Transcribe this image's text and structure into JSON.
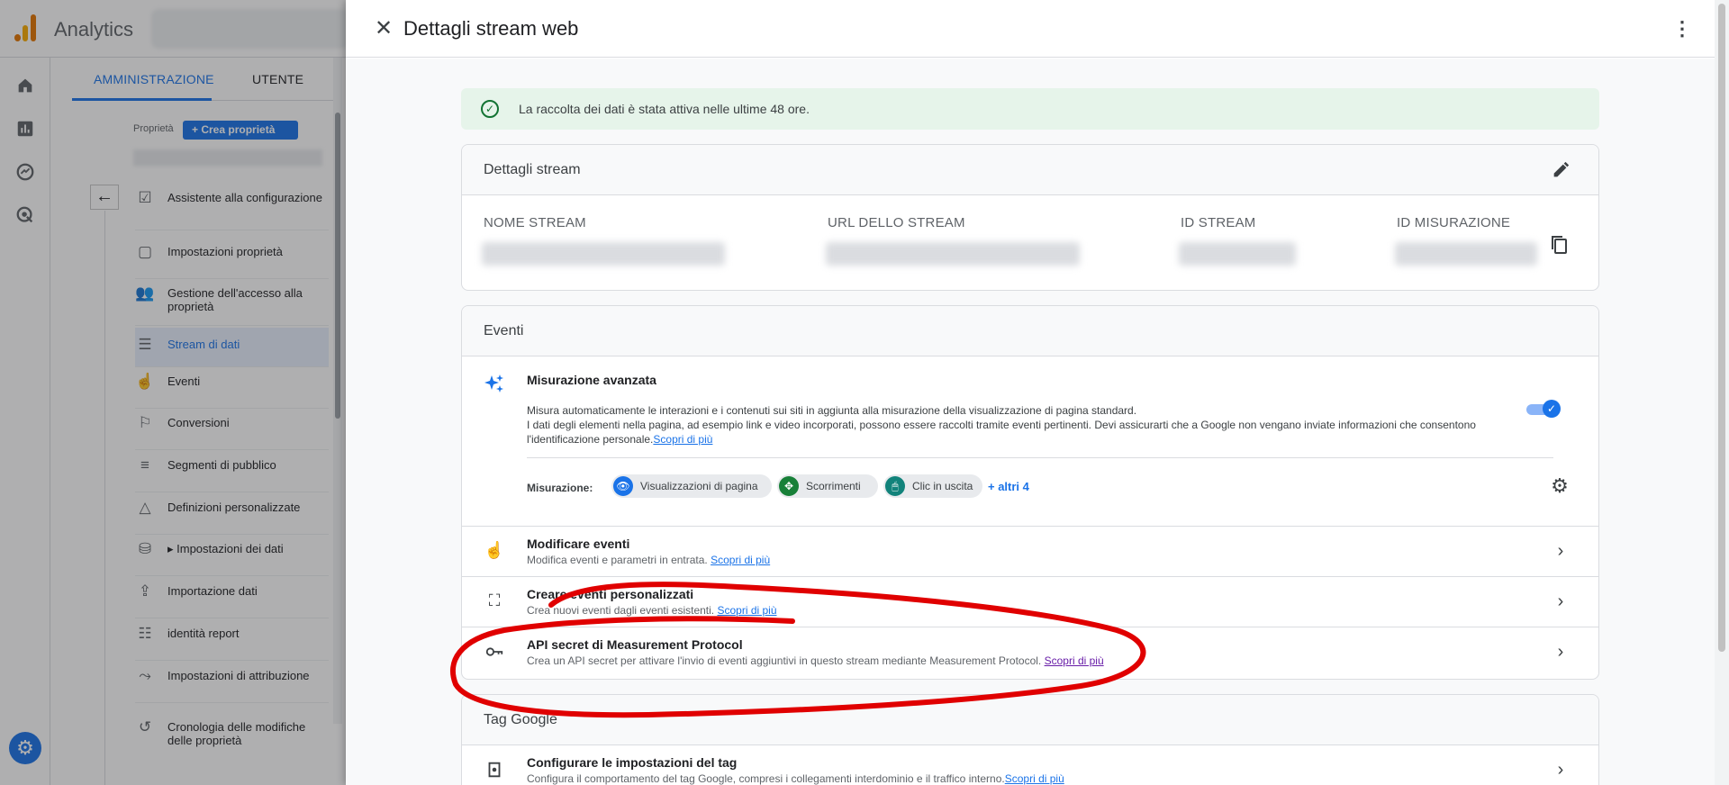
{
  "app": {
    "title": "Analytics"
  },
  "admin": {
    "tabs": [
      "AMMINISTRAZIONE",
      "UTENTE"
    ],
    "property_label": "Proprietà",
    "create_property": "Crea proprietà",
    "items": [
      {
        "label": "Assistente alla configurazione",
        "icon": "checklist-icon"
      },
      {
        "label": "Impostazioni proprietà",
        "icon": "property-settings-icon"
      },
      {
        "label": "Gestione dell'accesso alla proprietà",
        "icon": "people-icon"
      },
      {
        "label": "Stream di dati",
        "icon": "data-stream-icon"
      },
      {
        "label": "Eventi",
        "icon": "touch-icon"
      },
      {
        "label": "Conversioni",
        "icon": "flag-icon"
      },
      {
        "label": "Segmenti di pubblico",
        "icon": "audience-icon"
      },
      {
        "label": "Definizioni personalizzate",
        "icon": "shapes-icon"
      },
      {
        "label": "Impostazioni dei dati",
        "icon": "database-icon"
      },
      {
        "label": "Importazione dati",
        "icon": "upload-icon"
      },
      {
        "label": "identità report",
        "icon": "report-identity-icon"
      },
      {
        "label": "Impostazioni di attribuzione",
        "icon": "attribution-icon"
      },
      {
        "label": "Cronologia delle modifiche delle proprietà",
        "icon": "history-icon"
      }
    ]
  },
  "drawer": {
    "title": "Dettagli stream web",
    "banner": "La raccolta dei dati è stata attiva nelle ultime 48 ore.",
    "stream_details": {
      "title": "Dettagli stream",
      "columns": [
        "NOME STREAM",
        "URL DELLO STREAM",
        "ID STREAM",
        "ID MISURAZIONE"
      ]
    },
    "events": {
      "title": "Eventi",
      "enhanced": {
        "title": "Misurazione avanzata",
        "line1": "Misura automaticamente le interazioni e i contenuti sui siti in aggiunta alla misurazione della visualizzazione di pagina standard.",
        "line2": "I dati degli elementi nella pagina, ad esempio link e video incorporati, possono essere raccolti tramite eventi pertinenti. Devi assicurarti che a Google non vengano inviate informazioni che consentono l'identificazione personale.",
        "link": "Scopri di più",
        "toggle_on": true,
        "measurement_label": "Misurazione:",
        "chips": [
          "Visualizzazioni di pagina",
          "Scorrimenti",
          "Clic in uscita"
        ],
        "more": "+ altri 4"
      },
      "rows": [
        {
          "title": "Modificare eventi",
          "sub": "Modifica eventi e parametri in entrata.",
          "link": "Scopri di più"
        },
        {
          "title": "Creare eventi personalizzati",
          "sub": "Crea nuovi eventi dagli eventi esistenti.",
          "link": "Scopri di più"
        },
        {
          "title": "API secret di Measurement Protocol",
          "sub": "Crea un API secret per attivare l'invio di eventi aggiuntivi in questo stream mediante Measurement Protocol.",
          "link": "Scopri di più"
        }
      ]
    },
    "google_tag": {
      "title": "Tag Google",
      "row": {
        "title": "Configurare le impostazioni del tag",
        "sub": "Configura il comportamento del tag Google, compresi i collegamenti interdominio e il traffico interno.",
        "link": "Scopri di più"
      }
    }
  },
  "colors": {
    "accent": "#1a73e8",
    "annotation": "#e00000",
    "success_bg": "#e6f4ea"
  }
}
